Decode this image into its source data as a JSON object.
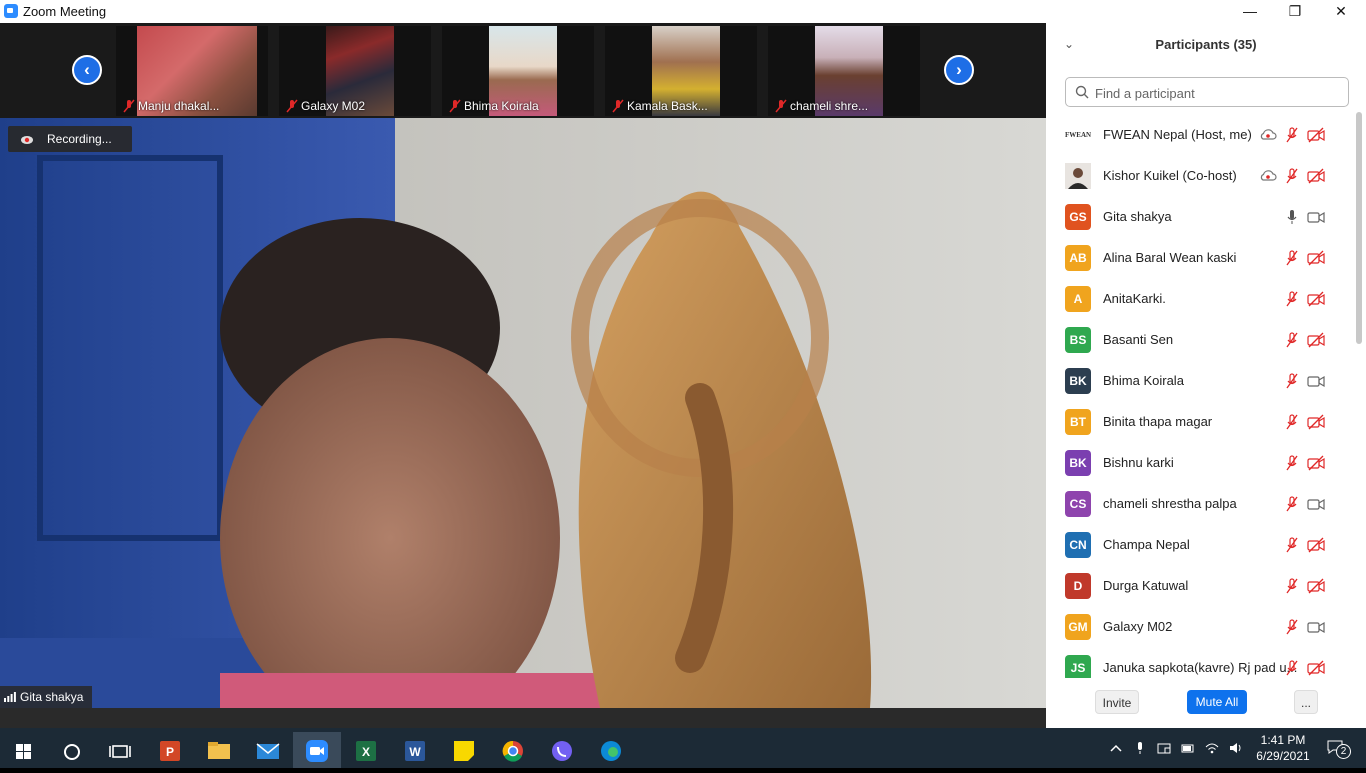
{
  "window": {
    "title": "Zoom Meeting",
    "minimize": "—",
    "restore": "❐",
    "close": "✕"
  },
  "strip": {
    "prev": "‹",
    "next": "›",
    "tiles": [
      {
        "name": "Manju dhakal..."
      },
      {
        "name": "Galaxy M02"
      },
      {
        "name": "Bhima Koirala"
      },
      {
        "name": "Kamala Bask..."
      },
      {
        "name": "chameli shre..."
      }
    ]
  },
  "main": {
    "recording": "Recording...",
    "speaker": "Gita shakya"
  },
  "panel": {
    "title": "Participants (35)",
    "search_placeholder": "Find a participant",
    "participants": [
      {
        "name": "FWEAN Nepal (Host, me)",
        "initials": "FWEAN",
        "color": "#ffffff"
      },
      {
        "name": "Kishor Kuikel (Co-host)",
        "initials": "",
        "color": "#6b4a3a"
      },
      {
        "name": "Gita shakya",
        "initials": "GS",
        "color": "#e0531f"
      },
      {
        "name": "Alina Baral Wean kaski",
        "initials": "AB",
        "color": "#f0a41e"
      },
      {
        "name": "AnitaKarki.",
        "initials": "A",
        "color": "#f0a41e"
      },
      {
        "name": "Basanti Sen",
        "initials": "BS",
        "color": "#2fa84f"
      },
      {
        "name": "Bhima Koirala",
        "initials": "BK",
        "color": "#2c3e50"
      },
      {
        "name": "Binita thapa magar",
        "initials": "BT",
        "color": "#f0a41e"
      },
      {
        "name": "Bishnu karki",
        "initials": "BK",
        "color": "#7b3fb0"
      },
      {
        "name": "chameli shrestha palpa",
        "initials": "CS",
        "color": "#8e44ad"
      },
      {
        "name": "Champa Nepal",
        "initials": "CN",
        "color": "#1f6fb2"
      },
      {
        "name": "Durga Katuwal",
        "initials": "D",
        "color": "#c0392b"
      },
      {
        "name": "Galaxy M02",
        "initials": "GM",
        "color": "#f0a41e"
      },
      {
        "name": "Januka sapkota(kavre) Rj pad u...",
        "initials": "JS",
        "color": "#2fa84f"
      }
    ],
    "invite": "Invite",
    "mute_all": "Mute All",
    "more": "..."
  },
  "taskbar": {
    "time": "1:41 PM",
    "date": "6/29/2021",
    "notifications": "2"
  }
}
